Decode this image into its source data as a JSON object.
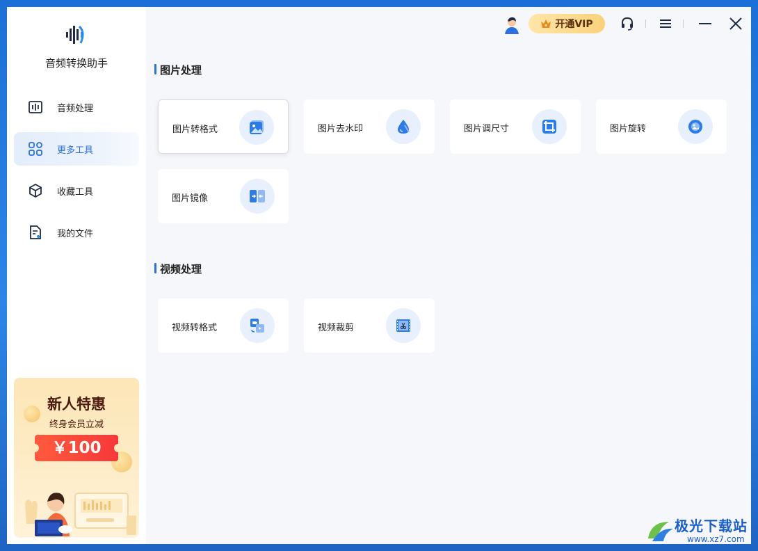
{
  "app": {
    "name": "音频转换助手"
  },
  "sidebar": {
    "items": [
      {
        "label": "音频处理",
        "icon": "waveform-icon"
      },
      {
        "label": "更多工具",
        "icon": "grid-icon",
        "active": true
      },
      {
        "label": "收藏工具",
        "icon": "cube-icon"
      },
      {
        "label": "我的文件",
        "icon": "file-icon"
      }
    ]
  },
  "promo": {
    "title": "新人特惠",
    "subtitle": "终身会员立减",
    "amount": "￥100"
  },
  "topbar": {
    "vip_label": "开通VIP"
  },
  "sections": [
    {
      "title": "图片处理",
      "tools": [
        {
          "label": "图片转格式",
          "icon": "image-convert-icon"
        },
        {
          "label": "图片去水印",
          "icon": "watermark-drop-icon"
        },
        {
          "label": "图片调尺寸",
          "icon": "crop-icon"
        },
        {
          "label": "图片旋转",
          "icon": "rotate-image-icon"
        },
        {
          "label": "图片镜像",
          "icon": "mirror-icon"
        }
      ]
    },
    {
      "title": "视频处理",
      "tools": [
        {
          "label": "视频转格式",
          "icon": "video-convert-icon"
        },
        {
          "label": "视频裁剪",
          "icon": "video-cut-icon"
        }
      ]
    }
  ],
  "watermark": {
    "text": "极光下载站",
    "url": "www.xz7.com"
  },
  "colors": {
    "accent": "#2b6fe0",
    "icon_bg": "#e7f0fc",
    "promo_red": "#f8383a",
    "vip_gold": "#f9d27a"
  }
}
